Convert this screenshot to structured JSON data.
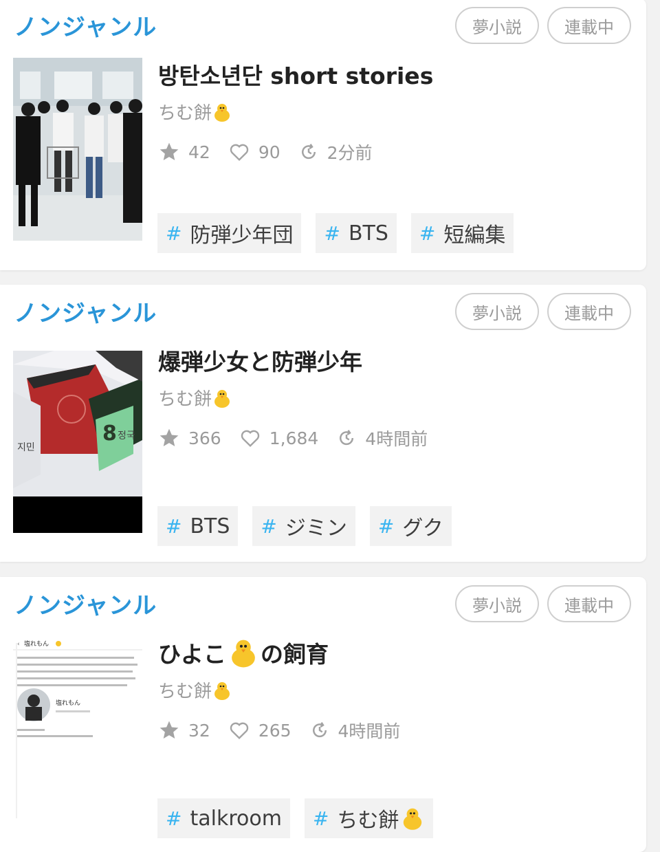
{
  "cards": [
    {
      "genre": "ノンジャンル",
      "badges": [
        "夢小説",
        "連載中"
      ],
      "title": "방탄소년단 short stories",
      "author": "ちむ餅",
      "stars": "42",
      "likes": "90",
      "updated": "2分前",
      "tags": [
        "防弾少年団",
        "BTS",
        "短編集"
      ]
    },
    {
      "genre": "ノンジャンル",
      "badges": [
        "夢小説",
        "連載中"
      ],
      "title": "爆弾少女と防弾少年",
      "author": "ちむ餅",
      "stars": "366",
      "likes": "1,684",
      "updated": "4時間前",
      "tags": [
        "BTS",
        "ジミン",
        "グク"
      ],
      "thumb_labels": [
        "지민",
        "정국"
      ]
    },
    {
      "genre": "ノンジャンル",
      "badges": [
        "夢小説",
        "連載中"
      ],
      "title_prefix": "ひよこ",
      "title_suffix": "の飼育",
      "author": "ちむ餅",
      "stars": "32",
      "likes": "265",
      "updated": "4時間前",
      "tags": [
        "talkroom",
        "ちむ餅"
      ],
      "thumb_labels": [
        "塩れもん"
      ]
    }
  ],
  "icons": {
    "star": "star-icon",
    "heart": "heart-icon",
    "updated": "clock-refresh-icon",
    "hash": "#",
    "chick": "chick-emoji-icon"
  },
  "colors": {
    "genre": "#2a95d8",
    "hash": "#39b4f0",
    "muted": "#9a9a9a",
    "tag_bg": "#f2f2f2"
  }
}
